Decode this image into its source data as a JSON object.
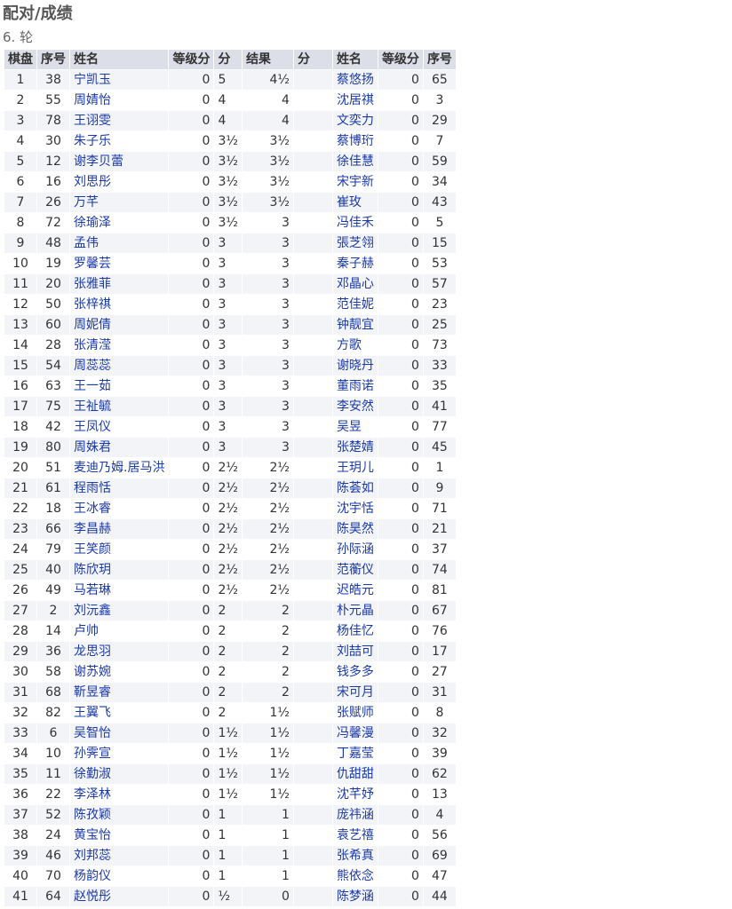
{
  "page": {
    "title": "配对/成绩",
    "round": "6. 轮"
  },
  "table": {
    "headers": {
      "board": "棋盘",
      "white_no": "序号",
      "white_name": "姓名",
      "white_rating": "等级分",
      "white_pts": "分",
      "result": "结果",
      "black_pts": "分",
      "black_name": "姓名",
      "black_rating": "等级分",
      "black_no": "序号"
    },
    "rows": [
      {
        "board": "1",
        "wno": "38",
        "wname": "宁凯玉",
        "wrating": "0",
        "wpts": "5",
        "result": "4½",
        "bname": "蔡悠扬",
        "brating": "0",
        "bno": "65"
      },
      {
        "board": "2",
        "wno": "55",
        "wname": "周婧怡",
        "wrating": "0",
        "wpts": "4",
        "result": "4",
        "bname": "沈居祺",
        "brating": "0",
        "bno": "3"
      },
      {
        "board": "3",
        "wno": "78",
        "wname": "王诩雯",
        "wrating": "0",
        "wpts": "4",
        "result": "4",
        "bname": "文奕力",
        "brating": "0",
        "bno": "29"
      },
      {
        "board": "4",
        "wno": "30",
        "wname": "朱子乐",
        "wrating": "0",
        "wpts": "3½",
        "result": "3½",
        "bname": "蔡博珩",
        "brating": "0",
        "bno": "7"
      },
      {
        "board": "5",
        "wno": "12",
        "wname": "谢李贝蕾",
        "wrating": "0",
        "wpts": "3½",
        "result": "3½",
        "bname": "徐佳慧",
        "brating": "0",
        "bno": "59"
      },
      {
        "board": "6",
        "wno": "16",
        "wname": "刘思彤",
        "wrating": "0",
        "wpts": "3½",
        "result": "3½",
        "bname": "宋宇新",
        "brating": "0",
        "bno": "34"
      },
      {
        "board": "7",
        "wno": "26",
        "wname": "万芊",
        "wrating": "0",
        "wpts": "3½",
        "result": "3½",
        "bname": "崔玫",
        "brating": "0",
        "bno": "43"
      },
      {
        "board": "8",
        "wno": "72",
        "wname": "徐瑜泽",
        "wrating": "0",
        "wpts": "3½",
        "result": "3",
        "bname": "冯佳禾",
        "brating": "0",
        "bno": "5"
      },
      {
        "board": "9",
        "wno": "48",
        "wname": "孟伟",
        "wrating": "0",
        "wpts": "3",
        "result": "3",
        "bname": "張芝翎",
        "brating": "0",
        "bno": "15"
      },
      {
        "board": "10",
        "wno": "19",
        "wname": "罗馨芸",
        "wrating": "0",
        "wpts": "3",
        "result": "3",
        "bname": "秦子赫",
        "brating": "0",
        "bno": "53"
      },
      {
        "board": "11",
        "wno": "20",
        "wname": "张雅菲",
        "wrating": "0",
        "wpts": "3",
        "result": "3",
        "bname": "邓晶心",
        "brating": "0",
        "bno": "57"
      },
      {
        "board": "12",
        "wno": "50",
        "wname": "张梓祺",
        "wrating": "0",
        "wpts": "3",
        "result": "3",
        "bname": "范佳妮",
        "brating": "0",
        "bno": "23"
      },
      {
        "board": "13",
        "wno": "60",
        "wname": "周妮倩",
        "wrating": "0",
        "wpts": "3",
        "result": "3",
        "bname": "钟靓宜",
        "brating": "0",
        "bno": "25"
      },
      {
        "board": "14",
        "wno": "28",
        "wname": "张清滢",
        "wrating": "0",
        "wpts": "3",
        "result": "3",
        "bname": "方歌",
        "brating": "0",
        "bno": "73"
      },
      {
        "board": "15",
        "wno": "54",
        "wname": "周蕊蕊",
        "wrating": "0",
        "wpts": "3",
        "result": "3",
        "bname": "谢晓丹",
        "brating": "0",
        "bno": "33"
      },
      {
        "board": "16",
        "wno": "63",
        "wname": "王一茹",
        "wrating": "0",
        "wpts": "3",
        "result": "3",
        "bname": "董雨诺",
        "brating": "0",
        "bno": "35"
      },
      {
        "board": "17",
        "wno": "75",
        "wname": "王祉毓",
        "wrating": "0",
        "wpts": "3",
        "result": "3",
        "bname": "李安然",
        "brating": "0",
        "bno": "41"
      },
      {
        "board": "18",
        "wno": "42",
        "wname": "王凤仪",
        "wrating": "0",
        "wpts": "3",
        "result": "3",
        "bname": "吴昱",
        "brating": "0",
        "bno": "77"
      },
      {
        "board": "19",
        "wno": "80",
        "wname": "周姝君",
        "wrating": "0",
        "wpts": "3",
        "result": "3",
        "bname": "张楚婧",
        "brating": "0",
        "bno": "45"
      },
      {
        "board": "20",
        "wno": "51",
        "wname": "麦迪乃姆.居马洪",
        "wrating": "0",
        "wpts": "2½",
        "result": "2½",
        "bname": "王玥儿",
        "brating": "0",
        "bno": "1"
      },
      {
        "board": "21",
        "wno": "61",
        "wname": "程雨恬",
        "wrating": "0",
        "wpts": "2½",
        "result": "2½",
        "bname": "陈荟如",
        "brating": "0",
        "bno": "9"
      },
      {
        "board": "22",
        "wno": "18",
        "wname": "王冰睿",
        "wrating": "0",
        "wpts": "2½",
        "result": "2½",
        "bname": "沈宇恬",
        "brating": "0",
        "bno": "71"
      },
      {
        "board": "23",
        "wno": "66",
        "wname": "李昌赫",
        "wrating": "0",
        "wpts": "2½",
        "result": "2½",
        "bname": "陈昊然",
        "brating": "0",
        "bno": "21"
      },
      {
        "board": "24",
        "wno": "79",
        "wname": "王笑颜",
        "wrating": "0",
        "wpts": "2½",
        "result": "2½",
        "bname": "孙际涵",
        "brating": "0",
        "bno": "37"
      },
      {
        "board": "25",
        "wno": "40",
        "wname": "陈欣玥",
        "wrating": "0",
        "wpts": "2½",
        "result": "2½",
        "bname": "范蘅仪",
        "brating": "0",
        "bno": "74"
      },
      {
        "board": "26",
        "wno": "49",
        "wname": "马若琳",
        "wrating": "0",
        "wpts": "2½",
        "result": "2½",
        "bname": "迟皓元",
        "brating": "0",
        "bno": "81"
      },
      {
        "board": "27",
        "wno": "2",
        "wname": "刘沅鑫",
        "wrating": "0",
        "wpts": "2",
        "result": "2",
        "bname": "朴元晶",
        "brating": "0",
        "bno": "67"
      },
      {
        "board": "28",
        "wno": "14",
        "wname": "卢帅",
        "wrating": "0",
        "wpts": "2",
        "result": "2",
        "bname": "杨佳忆",
        "brating": "0",
        "bno": "76"
      },
      {
        "board": "29",
        "wno": "36",
        "wname": "龙思羽",
        "wrating": "0",
        "wpts": "2",
        "result": "2",
        "bname": "刘喆可",
        "brating": "0",
        "bno": "17"
      },
      {
        "board": "30",
        "wno": "58",
        "wname": "谢苏婉",
        "wrating": "0",
        "wpts": "2",
        "result": "2",
        "bname": "钱多多",
        "brating": "0",
        "bno": "27"
      },
      {
        "board": "31",
        "wno": "68",
        "wname": "靳昱睿",
        "wrating": "0",
        "wpts": "2",
        "result": "2",
        "bname": "宋可月",
        "brating": "0",
        "bno": "31"
      },
      {
        "board": "32",
        "wno": "82",
        "wname": "王翼飞",
        "wrating": "0",
        "wpts": "2",
        "result": "1½",
        "bname": "张赋师",
        "brating": "0",
        "bno": "8"
      },
      {
        "board": "33",
        "wno": "6",
        "wname": "吴智怡",
        "wrating": "0",
        "wpts": "1½",
        "result": "1½",
        "bname": "冯馨漫",
        "brating": "0",
        "bno": "32"
      },
      {
        "board": "34",
        "wno": "10",
        "wname": "孙霁宣",
        "wrating": "0",
        "wpts": "1½",
        "result": "1½",
        "bname": "丁嘉莹",
        "brating": "0",
        "bno": "39"
      },
      {
        "board": "35",
        "wno": "11",
        "wname": "徐勤淑",
        "wrating": "0",
        "wpts": "1½",
        "result": "1½",
        "bname": "仇甜甜",
        "brating": "0",
        "bno": "62"
      },
      {
        "board": "36",
        "wno": "22",
        "wname": "李泽林",
        "wrating": "0",
        "wpts": "1½",
        "result": "1½",
        "bname": "沈芊妤",
        "brating": "0",
        "bno": "13"
      },
      {
        "board": "37",
        "wno": "52",
        "wname": "陈孜颖",
        "wrating": "0",
        "wpts": "1",
        "result": "1",
        "bname": "庞祎涵",
        "brating": "0",
        "bno": "4"
      },
      {
        "board": "38",
        "wno": "24",
        "wname": "黄宝怡",
        "wrating": "0",
        "wpts": "1",
        "result": "1",
        "bname": "袁艺禧",
        "brating": "0",
        "bno": "56"
      },
      {
        "board": "39",
        "wno": "46",
        "wname": "刘邦蕊",
        "wrating": "0",
        "wpts": "1",
        "result": "1",
        "bname": "张希真",
        "brating": "0",
        "bno": "69"
      },
      {
        "board": "40",
        "wno": "70",
        "wname": "杨韵仪",
        "wrating": "0",
        "wpts": "1",
        "result": "1",
        "bname": "熊依念",
        "brating": "0",
        "bno": "47"
      },
      {
        "board": "41",
        "wno": "64",
        "wname": "赵悦彤",
        "wrating": "0",
        "wpts": "½",
        "result": "0",
        "bname": "陈梦涵",
        "brating": "0",
        "bno": "44"
      }
    ]
  }
}
